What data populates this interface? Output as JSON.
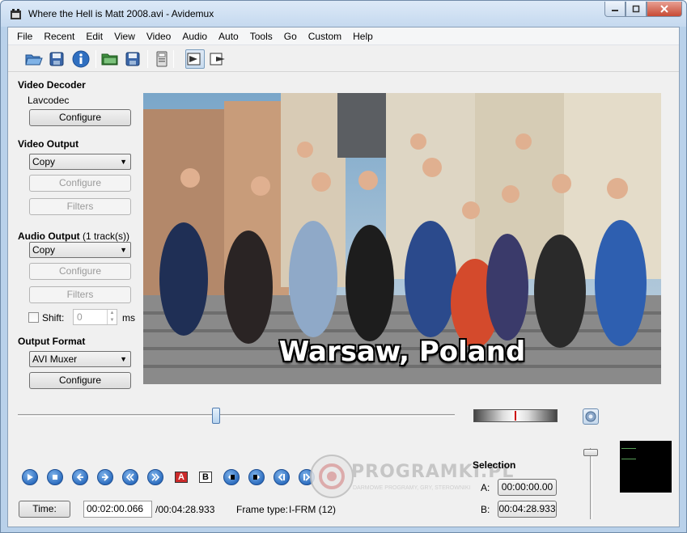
{
  "window": {
    "title": "Where the Hell is Matt 2008.avi - Avidemux",
    "buttons": {
      "minimize": "",
      "maximize": "",
      "close": ""
    }
  },
  "menubar": [
    "File",
    "Recent",
    "Edit",
    "View",
    "Video",
    "Audio",
    "Auto",
    "Tools",
    "Go",
    "Custom",
    "Help"
  ],
  "toolbar": {
    "icons": [
      "open-folder-icon",
      "save-icon",
      "info-icon",
      "open-folder-green-icon",
      "save-as-icon",
      "calculator-icon",
      "input-mode-icon",
      "output-mode-icon"
    ]
  },
  "left_panel": {
    "video_decoder": {
      "title": "Video Decoder",
      "codec": "Lavcodec",
      "configure": "Configure"
    },
    "video_output": {
      "title": "Video Output",
      "selected": "Copy",
      "configure": "Configure",
      "filters": "Filters"
    },
    "audio_output": {
      "title": "Audio Output",
      "tracks": "(1 track(s))",
      "selected": "Copy",
      "configure": "Configure",
      "filters": "Filters",
      "shift_label": "Shift:",
      "shift_value": "0",
      "shift_unit": "ms"
    },
    "output_format": {
      "title": "Output Format",
      "selected": "AVI Muxer",
      "configure": "Configure"
    }
  },
  "video": {
    "subtitle": "Warsaw, Poland"
  },
  "timeline": {
    "position": 0.453
  },
  "playback_icons": [
    "play-icon",
    "stop-icon",
    "previous-frame-icon",
    "next-frame-icon",
    "previous-keyframe-icon",
    "next-keyframe-icon",
    "set-marker-a-icon",
    "set-marker-b-icon",
    "previous-black-frame-icon",
    "next-black-frame-icon",
    "goto-marker-a-icon",
    "goto-marker-b-icon"
  ],
  "markers": {
    "a": "A",
    "b": "B"
  },
  "status": {
    "time_button": "Time:",
    "current_time": "00:02:00.066",
    "total_time": "/00:04:28.933",
    "frame_type_label": "Frame type:",
    "frame_type_value": "I-FRM (12)"
  },
  "selection": {
    "title": "Selection",
    "a_label": "A:",
    "a_value": "00:00:00.00",
    "b_label": "B:",
    "b_value": "00:04:28.933"
  },
  "watermark": {
    "brand": "PROGRAMKI.PL",
    "tagline": "DARMOWE PROGRAMY, GRY, STEROWNIKI"
  },
  "colors": {
    "accent": "#2f6fc0",
    "frame_border": "#b9d1ea",
    "marker_red": "#cc0000"
  }
}
